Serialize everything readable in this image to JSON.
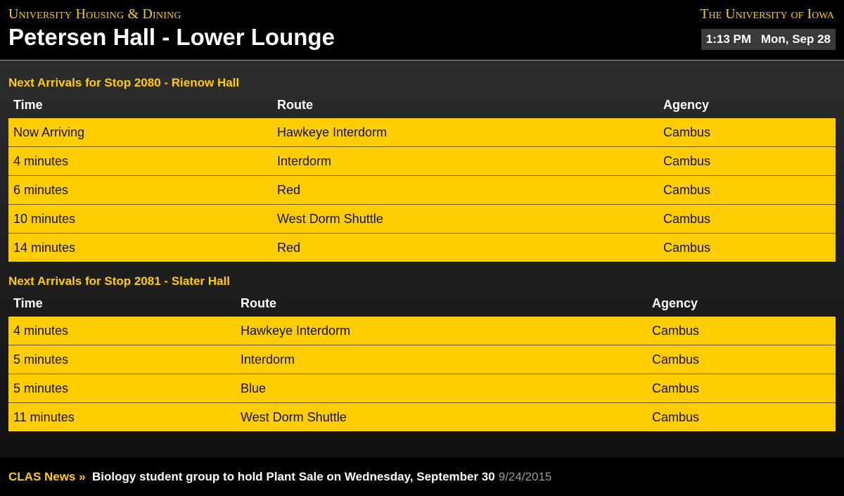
{
  "header": {
    "org_name": "University Housing & Dining",
    "page_title": "Petersen Hall - Lower Lounge",
    "university_name": "The University of Iowa",
    "time": "1:13 PM",
    "date": "Mon, Sep 28"
  },
  "stops": [
    {
      "heading": "Next Arrivals for Stop 2080 - Rienow Hall",
      "columns": [
        "Time",
        "Route",
        "Agency"
      ],
      "rows": [
        [
          "Now Arriving",
          "Hawkeye Interdorm",
          "Cambus"
        ],
        [
          "4 minutes",
          "Interdorm",
          "Cambus"
        ],
        [
          "6 minutes",
          "Red",
          "Cambus"
        ],
        [
          "10 minutes",
          "West Dorm Shuttle",
          "Cambus"
        ],
        [
          "14 minutes",
          "Red",
          "Cambus"
        ]
      ]
    },
    {
      "heading": "Next Arrivals for Stop 2081 - Slater Hall",
      "columns": [
        "Time",
        "Route",
        "Agency"
      ],
      "rows": [
        [
          "4 minutes",
          "Hawkeye Interdorm",
          "Cambus"
        ],
        [
          "5 minutes",
          "Interdorm",
          "Cambus"
        ],
        [
          "5 minutes",
          "Blue",
          "Cambus"
        ],
        [
          "11 minutes",
          "West Dorm Shuttle",
          "Cambus"
        ]
      ]
    }
  ],
  "news": {
    "source": "CLAS News »",
    "headline": "Biology student group to hold Plant Sale on Wednesday, September 30",
    "date": "9/24/2015"
  },
  "colors": {
    "accent": "#ffcd00",
    "background": "#151515",
    "header_bg": "#000000",
    "clock_bg": "#3a3a3a"
  }
}
